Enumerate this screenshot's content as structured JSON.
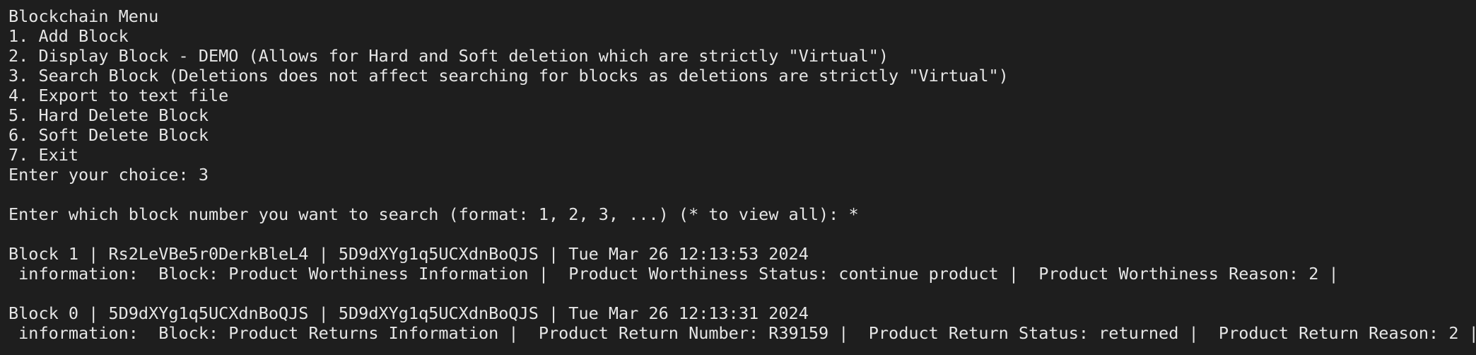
{
  "terminal": {
    "menu": {
      "title": "Blockchain Menu",
      "items": [
        "1. Add Block",
        "2. Display Block - DEMO (Allows for Hard and Soft deletion which are strictly \"Virtual\")",
        "3. Search Block (Deletions does not affect searching for blocks as deletions are strictly \"Virtual\")",
        "4. Export to text file",
        "5. Hard Delete Block",
        "6. Soft Delete Block",
        "7. Exit"
      ],
      "choice_prompt": "Enter your choice: 3"
    },
    "search_prompt": "Enter which block number you want to search (format: 1, 2, 3, ...) (* to view all): *",
    "blocks": [
      {
        "header": "Block 1 | Rs2LeVBe5r0DerkBleL4 | 5D9dXYg1q5UCXdnBoQJS | Tue Mar 26 12:13:53 2024",
        "information": " information:  Block: Product Worthiness Information |  Product Worthiness Status: continue product |  Product Worthiness Reason: 2 |"
      },
      {
        "header": "Block 0 | 5D9dXYg1q5UCXdnBoQJS | 5D9dXYg1q5UCXdnBoQJS | Tue Mar 26 12:13:31 2024",
        "information": " information:  Block: Product Returns Information |  Product Return Number: R39159 |  Product Return Status: returned |  Product Return Reason: 2 |"
      }
    ]
  }
}
